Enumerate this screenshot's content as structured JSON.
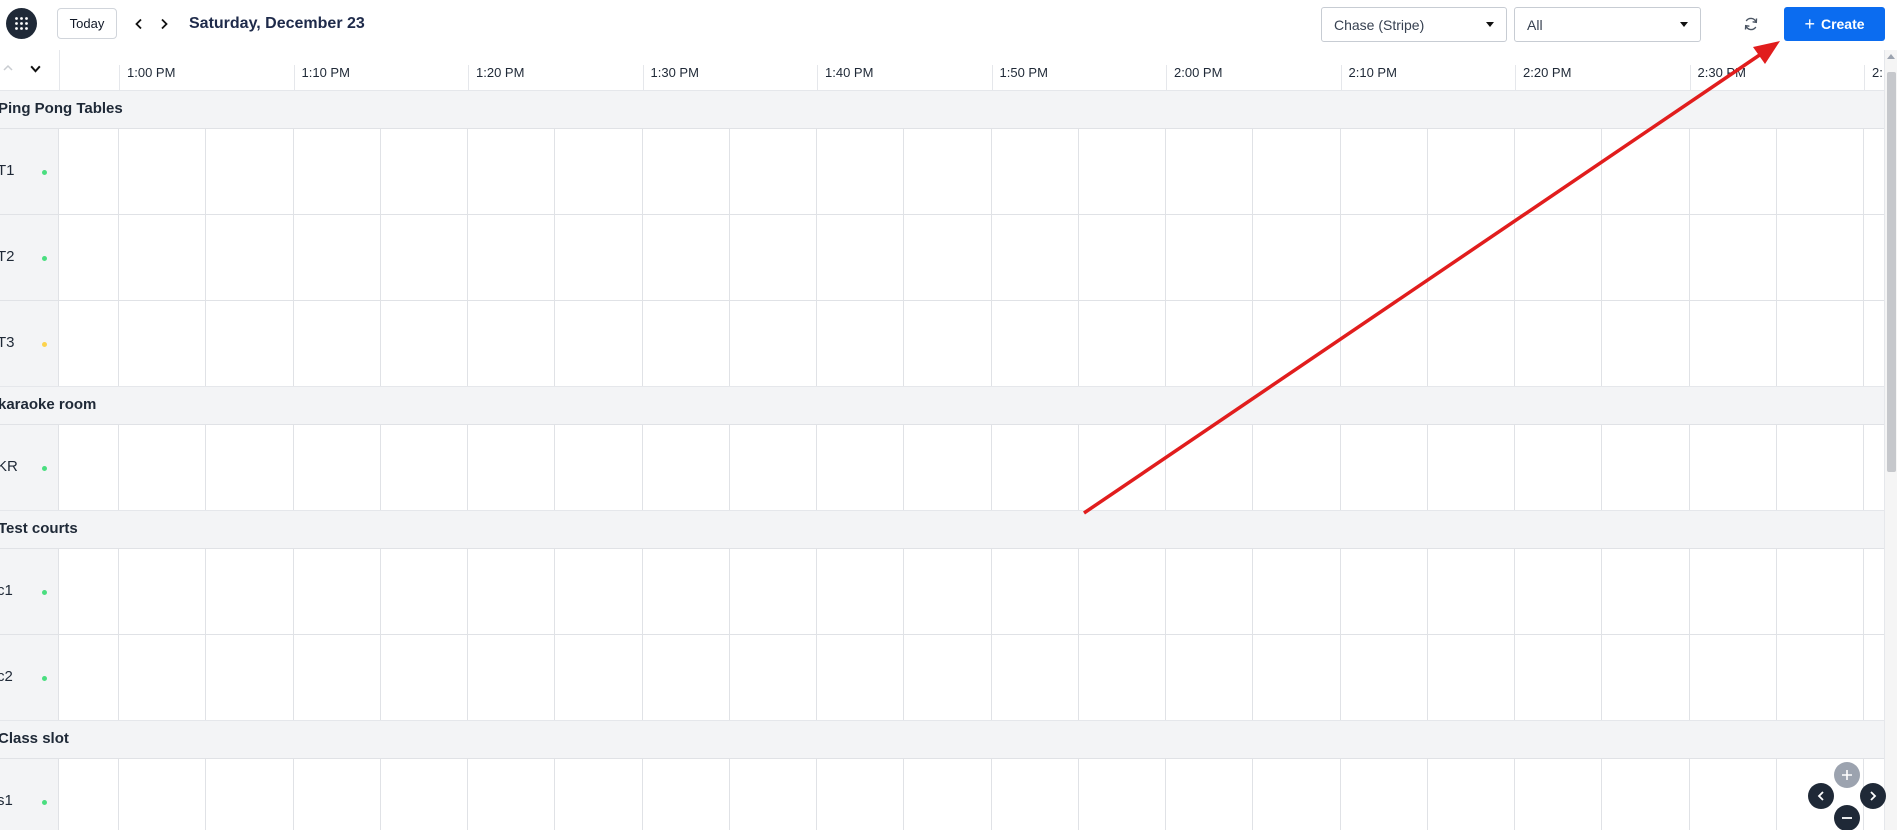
{
  "header": {
    "today_label": "Today",
    "date_title": "Saturday, December 23",
    "account_select": {
      "value": "Chase (Stripe)"
    },
    "filter_select": {
      "value": "All"
    },
    "create_label": "Create"
  },
  "timeline": {
    "times": [
      "1:00 PM",
      "1:10 PM",
      "1:20 PM",
      "1:30 PM",
      "1:40 PM",
      "1:50 PM",
      "2:00 PM",
      "2:10 PM",
      "2:20 PM",
      "2:30 PM",
      "2:"
    ]
  },
  "groups": [
    {
      "name": "Ping Pong Tables",
      "resources": [
        {
          "name": "T1",
          "status_color": "#4ade80"
        },
        {
          "name": "T2",
          "status_color": "#4ade80"
        },
        {
          "name": "T3",
          "status_color": "#fcd34d"
        }
      ]
    },
    {
      "name": "karaoke room",
      "resources": [
        {
          "name": "KR",
          "status_color": "#4ade80"
        }
      ]
    },
    {
      "name": "Test courts",
      "resources": [
        {
          "name": "c1",
          "status_color": "#4ade80"
        },
        {
          "name": "c2",
          "status_color": "#4ade80"
        }
      ]
    },
    {
      "name": "Class slot",
      "resources": [
        {
          "name": "s1",
          "status_color": "#4ade80"
        }
      ]
    }
  ],
  "icons": {
    "apps": "grid-apps-icon",
    "prev": "chevron-left-icon",
    "next": "chevron-right-icon",
    "refresh": "refresh-icon",
    "create": "plus-icon",
    "collapse": "chevron-up-icon",
    "expand": "chevron-down-icon"
  },
  "colors": {
    "accent": "#0b6cf0",
    "dark": "#1f2937",
    "annotation": "#e11d1d",
    "group_bg": "#f3f4f6"
  }
}
